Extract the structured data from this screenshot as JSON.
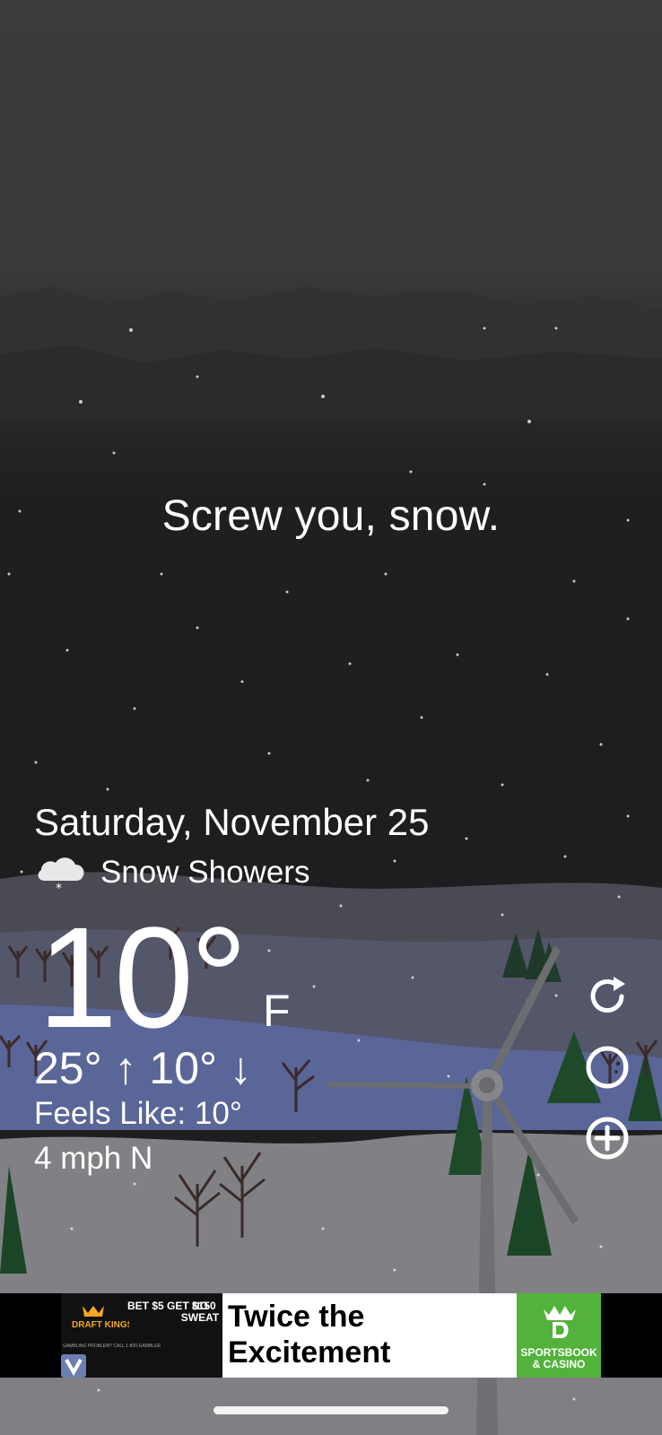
{
  "tagline": "Screw you, snow.",
  "weather": {
    "date": "Saturday, November 25",
    "condition": "Snow Showers",
    "condition_icon": "cloud-snow-icon",
    "temperature": "10°",
    "unit": "F",
    "hi_lo": "25° ↑  10° ↓",
    "feels_like": "Feels Like: 10°",
    "wind": "4 mph N"
  },
  "side_buttons": [
    {
      "name": "refresh-icon"
    },
    {
      "name": "moon-phase-icon"
    },
    {
      "name": "add-location-icon"
    }
  ],
  "ad": {
    "draftkings_logo": "DRAFT KINGS",
    "bet_offer": "BET $5 GET $150",
    "no_sweat": "NO SWEAT",
    "fine_print": "GAMBLING PROBLEM? CALL 1-800-GAMBLER",
    "headline": "Twice the Excitement",
    "sportsbook": "SPORTSBOOK & CASINO",
    "brand_green": "#53b23b"
  }
}
